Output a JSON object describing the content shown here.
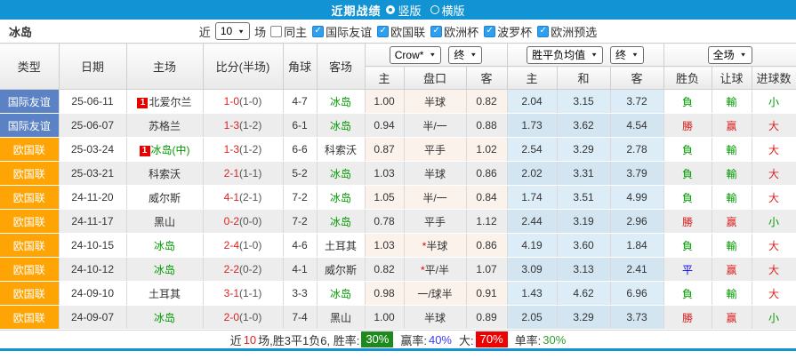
{
  "topbar": {
    "title": "近期战绩",
    "radio_options": [
      {
        "label": "竖版",
        "selected": true
      },
      {
        "label": "横版",
        "selected": false
      }
    ]
  },
  "filterbar": {
    "team": "冰岛",
    "recent_label": "近",
    "count_select": "10",
    "matches_label": "场",
    "checkboxes": [
      {
        "label": "同主",
        "checked": false
      },
      {
        "label": "国际友谊",
        "checked": true
      },
      {
        "label": "欧国联",
        "checked": true
      },
      {
        "label": "欧洲杯",
        "checked": true
      },
      {
        "label": "波罗杯",
        "checked": true
      },
      {
        "label": "欧洲预选",
        "checked": true
      }
    ]
  },
  "table": {
    "base_headers": [
      "类型",
      "日期",
      "主场",
      "比分(半场)",
      "角球",
      "客场"
    ],
    "groups": [
      {
        "selects": [
          "Crow*",
          "终"
        ],
        "subheaders": [
          "主",
          "盘口",
          "客"
        ]
      },
      {
        "selects": [
          "胜平负均值",
          "终"
        ],
        "subheaders": [
          "主",
          "和",
          "客"
        ]
      },
      {
        "selects": [
          "全场"
        ],
        "subheaders": [
          "胜负",
          "让球",
          "进球数"
        ]
      }
    ],
    "rows": [
      {
        "type": "国际友谊",
        "date": "25-06-11",
        "home_badge": "1",
        "home": "北爱尔兰",
        "home_green": false,
        "score": "1-0",
        "half": "(1-0)",
        "corner": "4-7",
        "away": "冰岛",
        "away_green": true,
        "asia_home": "1.00",
        "handicap_star": "",
        "handicap": "半球",
        "asia_away": "0.82",
        "eu_home": "2.04",
        "eu_draw": "3.15",
        "eu_away": "3.72",
        "result_wdl": "負",
        "result_handicap": "輸",
        "result_goals": "小"
      },
      {
        "type": "国际友谊",
        "date": "25-06-07",
        "home_badge": "",
        "home": "苏格兰",
        "home_green": false,
        "score": "1-3",
        "half": "(1-2)",
        "corner": "6-1",
        "away": "冰岛",
        "away_green": true,
        "asia_home": "0.94",
        "handicap_star": "",
        "handicap": "半/一",
        "asia_away": "0.88",
        "eu_home": "1.73",
        "eu_draw": "3.62",
        "eu_away": "4.54",
        "result_wdl": "勝",
        "result_handicap": "赢",
        "result_goals": "大"
      },
      {
        "type": "欧国联",
        "date": "25-03-24",
        "home_badge": "1",
        "home": "冰岛(中)",
        "home_green": true,
        "score": "1-3",
        "half": "(1-2)",
        "corner": "6-6",
        "away": "科索沃",
        "away_green": false,
        "asia_home": "0.87",
        "handicap_star": "",
        "handicap": "平手",
        "asia_away": "1.02",
        "eu_home": "2.54",
        "eu_draw": "3.29",
        "eu_away": "2.78",
        "result_wdl": "負",
        "result_handicap": "輸",
        "result_goals": "大"
      },
      {
        "type": "欧国联",
        "date": "25-03-21",
        "home_badge": "",
        "home": "科索沃",
        "home_green": false,
        "score": "2-1",
        "half": "(1-1)",
        "corner": "5-2",
        "away": "冰岛",
        "away_green": true,
        "asia_home": "1.03",
        "handicap_star": "",
        "handicap": "半球",
        "asia_away": "0.86",
        "eu_home": "2.02",
        "eu_draw": "3.31",
        "eu_away": "3.79",
        "result_wdl": "負",
        "result_handicap": "輸",
        "result_goals": "大"
      },
      {
        "type": "欧国联",
        "date": "24-11-20",
        "home_badge": "",
        "home": "威尔斯",
        "home_green": false,
        "score": "4-1",
        "half": "(2-1)",
        "corner": "7-2",
        "away": "冰岛",
        "away_green": true,
        "asia_home": "1.05",
        "handicap_star": "",
        "handicap": "半/一",
        "asia_away": "0.84",
        "eu_home": "1.74",
        "eu_draw": "3.51",
        "eu_away": "4.99",
        "result_wdl": "負",
        "result_handicap": "輸",
        "result_goals": "大"
      },
      {
        "type": "欧国联",
        "date": "24-11-17",
        "home_badge": "",
        "home": "黑山",
        "home_green": false,
        "score": "0-2",
        "half": "(0-0)",
        "corner": "7-2",
        "away": "冰岛",
        "away_green": true,
        "asia_home": "0.78",
        "handicap_star": "",
        "handicap": "平手",
        "asia_away": "1.12",
        "eu_home": "2.44",
        "eu_draw": "3.19",
        "eu_away": "2.96",
        "result_wdl": "勝",
        "result_handicap": "赢",
        "result_goals": "小"
      },
      {
        "type": "欧国联",
        "date": "24-10-15",
        "home_badge": "",
        "home": "冰岛",
        "home_green": true,
        "score": "2-4",
        "half": "(1-0)",
        "corner": "4-6",
        "away": "土耳其",
        "away_green": false,
        "asia_home": "1.03",
        "handicap_star": "*",
        "handicap": "半球",
        "asia_away": "0.86",
        "eu_home": "4.19",
        "eu_draw": "3.60",
        "eu_away": "1.84",
        "result_wdl": "負",
        "result_handicap": "輸",
        "result_goals": "大"
      },
      {
        "type": "欧国联",
        "date": "24-10-12",
        "home_badge": "",
        "home": "冰岛",
        "home_green": true,
        "score": "2-2",
        "half": "(0-2)",
        "corner": "4-1",
        "away": "威尔斯",
        "away_green": false,
        "asia_home": "0.82",
        "handicap_star": "*",
        "handicap": "平/半",
        "asia_away": "1.07",
        "eu_home": "3.09",
        "eu_draw": "3.13",
        "eu_away": "2.41",
        "result_wdl": "平",
        "result_handicap": "赢",
        "result_goals": "大"
      },
      {
        "type": "欧国联",
        "date": "24-09-10",
        "home_badge": "",
        "home": "土耳其",
        "home_green": false,
        "score": "3-1",
        "half": "(1-1)",
        "corner": "3-3",
        "away": "冰岛",
        "away_green": true,
        "asia_home": "0.98",
        "handicap_star": "",
        "handicap": "一/球半",
        "asia_away": "0.91",
        "eu_home": "1.43",
        "eu_draw": "4.62",
        "eu_away": "6.96",
        "result_wdl": "負",
        "result_handicap": "輸",
        "result_goals": "大"
      },
      {
        "type": "欧国联",
        "date": "24-09-07",
        "home_badge": "",
        "home": "冰岛",
        "home_green": true,
        "score": "2-0",
        "half": "(1-0)",
        "corner": "7-4",
        "away": "黑山",
        "away_green": false,
        "asia_home": "1.00",
        "handicap_star": "",
        "handicap": "半球",
        "asia_away": "0.89",
        "eu_home": "2.05",
        "eu_draw": "3.29",
        "eu_away": "3.73",
        "result_wdl": "勝",
        "result_handicap": "赢",
        "result_goals": "小"
      }
    ]
  },
  "footer": {
    "recent_label": "近",
    "recent_count": "10",
    "summary": "场,胜3平1负6, 胜率:",
    "win_rate": "30%",
    "profit_label": "赢率:",
    "profit_rate": "40%",
    "big_label": "大:",
    "big_rate": "70%",
    "single_label": "单率:",
    "single_rate": "30%"
  },
  "colors": {
    "topbar_bg": "#1193d4",
    "type_badges": {
      "国际友谊": "#5b82c5",
      "欧国联": "#ffa405"
    },
    "result_text": {
      "勝": "#dd2222",
      "赢": "#dd2222",
      "大": "#dd2222",
      "負": "#009900",
      "輸": "#009900",
      "小": "#009900",
      "平": "#0000ee"
    },
    "team_highlight": "#009900",
    "score_text": "#dd2222",
    "win_rate_badge_bg": "#1e8a1e",
    "big_rate_badge_bg": "#ee0000",
    "profit_rate_text": "#3b3bff",
    "single_rate_text": "#2f9e2f"
  }
}
